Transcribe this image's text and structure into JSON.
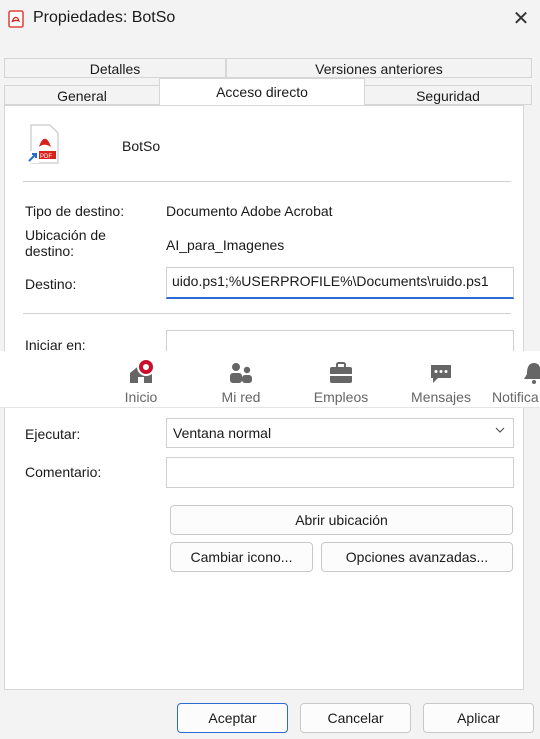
{
  "window": {
    "title": "Propiedades: BotSo",
    "close_glyph": "✕"
  },
  "tabs": {
    "row1": [
      "Detalles",
      "Versiones anteriores"
    ],
    "row2": [
      "General",
      "Acceso directo",
      "Seguridad"
    ],
    "active": "Acceso directo"
  },
  "file": {
    "name": "BotSo",
    "icon": "pdf-shortcut-icon"
  },
  "fields": {
    "tipo_label": "Tipo de destino:",
    "tipo_value": "Documento Adobe Acrobat",
    "ubicacion_label_1": "Ubicación de",
    "ubicacion_label_2": "destino:",
    "ubicacion_value": "AI_para_Imagenes",
    "destino_label": "Destino:",
    "destino_value": "uido.ps1;%USERPROFILE%\\Documents\\ruido.ps1",
    "iniciar_label": "Iniciar en:",
    "iniciar_value": "",
    "ejecutar_label": "Ejecutar:",
    "ejecutar_value": "Ventana normal",
    "comentario_label": "Comentario:",
    "comentario_value": ""
  },
  "buttons": {
    "abrir": "Abrir ubicación",
    "cambiar_icono": "Cambiar icono...",
    "opciones": "Opciones avanzadas...",
    "aceptar": "Aceptar",
    "cancelar": "Cancelar",
    "aplicar": "Aplicar"
  },
  "overlay_nav": {
    "items": [
      {
        "label": "Inicio",
        "icon": "home-icon",
        "badge": true
      },
      {
        "label": "Mi red",
        "icon": "network-icon",
        "badge": false
      },
      {
        "label": "Empleos",
        "icon": "briefcase-icon",
        "badge": false
      },
      {
        "label": "Mensajes",
        "icon": "messages-icon",
        "badge": false
      },
      {
        "label": "Notifica",
        "icon": "bell-icon",
        "badge": false
      }
    ]
  },
  "colors": {
    "accent": "#2b6bd6",
    "pdf_red": "#d8231b",
    "badge_red": "#c8102e",
    "nav_icon": "#666666"
  }
}
